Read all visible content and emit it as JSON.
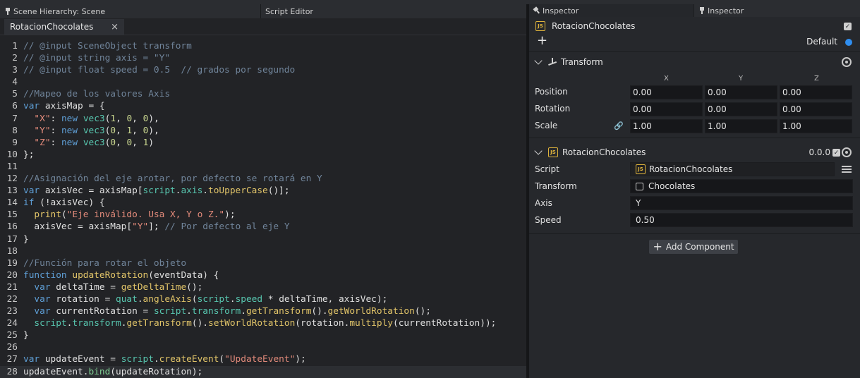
{
  "panel_tabs": {
    "hierarchy": "Scene Hierarchy: Scene",
    "script_editor": "Script Editor"
  },
  "file_tab": {
    "name": "RotacionChocolates",
    "close": "×"
  },
  "code_lines": [
    [
      [
        "c-com",
        "// @input SceneObject transform"
      ]
    ],
    [
      [
        "c-com",
        "// @input string axis = \"Y\""
      ]
    ],
    [
      [
        "c-com",
        "// @input float speed = 0.5  // grados por segundo"
      ]
    ],
    [],
    [
      [
        "c-com",
        "//Mapeo de los valores Axis"
      ]
    ],
    [
      [
        "c-kw",
        "var"
      ],
      [
        "c-plain",
        " axisMap = {"
      ]
    ],
    [
      [
        "c-plain",
        "  "
      ],
      [
        "c-str",
        "\"X\""
      ],
      [
        "c-plain",
        ": "
      ],
      [
        "c-kw",
        "new"
      ],
      [
        "c-plain",
        " "
      ],
      [
        "c-prop",
        "vec3"
      ],
      [
        "c-plain",
        "("
      ],
      [
        "c-num",
        "1"
      ],
      [
        "c-plain",
        ", "
      ],
      [
        "c-num",
        "0"
      ],
      [
        "c-plain",
        ", "
      ],
      [
        "c-num",
        "0"
      ],
      [
        "c-plain",
        "),"
      ]
    ],
    [
      [
        "c-plain",
        "  "
      ],
      [
        "c-str",
        "\"Y\""
      ],
      [
        "c-plain",
        ": "
      ],
      [
        "c-kw",
        "new"
      ],
      [
        "c-plain",
        " "
      ],
      [
        "c-prop",
        "vec3"
      ],
      [
        "c-plain",
        "("
      ],
      [
        "c-num",
        "0"
      ],
      [
        "c-plain",
        ", "
      ],
      [
        "c-num",
        "1"
      ],
      [
        "c-plain",
        ", "
      ],
      [
        "c-num",
        "0"
      ],
      [
        "c-plain",
        "),"
      ]
    ],
    [
      [
        "c-plain",
        "  "
      ],
      [
        "c-str",
        "\"Z\""
      ],
      [
        "c-plain",
        ": "
      ],
      [
        "c-kw",
        "new"
      ],
      [
        "c-plain",
        " "
      ],
      [
        "c-prop",
        "vec3"
      ],
      [
        "c-plain",
        "("
      ],
      [
        "c-num",
        "0"
      ],
      [
        "c-plain",
        ", "
      ],
      [
        "c-num",
        "0"
      ],
      [
        "c-plain",
        ", "
      ],
      [
        "c-num",
        "1"
      ],
      [
        "c-plain",
        ")"
      ]
    ],
    [
      [
        "c-plain",
        "};"
      ]
    ],
    [],
    [
      [
        "c-com",
        "//Asignación del eje arotar, por defecto se rotará en Y"
      ]
    ],
    [
      [
        "c-kw",
        "var"
      ],
      [
        "c-plain",
        " axisVec = axisMap["
      ],
      [
        "c-prop",
        "script"
      ],
      [
        "c-plain",
        "."
      ],
      [
        "c-prop",
        "axis"
      ],
      [
        "c-plain",
        "."
      ],
      [
        "c-fn",
        "toUpperCase"
      ],
      [
        "c-plain",
        "()];"
      ]
    ],
    [
      [
        "c-kw",
        "if"
      ],
      [
        "c-plain",
        " (!axisVec) {"
      ]
    ],
    [
      [
        "c-plain",
        "  "
      ],
      [
        "c-fn",
        "print"
      ],
      [
        "c-plain",
        "("
      ],
      [
        "c-str",
        "\"Eje inválido. Usa X, Y o Z.\""
      ],
      [
        "c-plain",
        ");"
      ]
    ],
    [
      [
        "c-plain",
        "  axisVec = axisMap["
      ],
      [
        "c-str",
        "\"Y\""
      ],
      [
        "c-plain",
        "]; "
      ],
      [
        "c-com",
        "// Por defecto al eje Y"
      ]
    ],
    [
      [
        "c-plain",
        "}"
      ]
    ],
    [],
    [
      [
        "c-com",
        "//Función para rotar el objeto"
      ]
    ],
    [
      [
        "c-kw",
        "function"
      ],
      [
        "c-plain",
        " "
      ],
      [
        "c-fn",
        "updateRotation"
      ],
      [
        "c-plain",
        "(eventData) {"
      ]
    ],
    [
      [
        "c-plain",
        "  "
      ],
      [
        "c-kw",
        "var"
      ],
      [
        "c-plain",
        " deltaTime = "
      ],
      [
        "c-fn",
        "getDeltaTime"
      ],
      [
        "c-plain",
        "();"
      ]
    ],
    [
      [
        "c-plain",
        "  "
      ],
      [
        "c-kw",
        "var"
      ],
      [
        "c-plain",
        " rotation = "
      ],
      [
        "c-prop",
        "quat"
      ],
      [
        "c-plain",
        "."
      ],
      [
        "c-fn",
        "angleAxis"
      ],
      [
        "c-plain",
        "("
      ],
      [
        "c-prop",
        "script"
      ],
      [
        "c-plain",
        "."
      ],
      [
        "c-prop",
        "speed"
      ],
      [
        "c-plain",
        " * deltaTime, axisVec);"
      ]
    ],
    [
      [
        "c-plain",
        "  "
      ],
      [
        "c-kw",
        "var"
      ],
      [
        "c-plain",
        " currentRotation = "
      ],
      [
        "c-prop",
        "script"
      ],
      [
        "c-plain",
        "."
      ],
      [
        "c-prop",
        "transform"
      ],
      [
        "c-plain",
        "."
      ],
      [
        "c-fn",
        "getTransform"
      ],
      [
        "c-plain",
        "()."
      ],
      [
        "c-fn",
        "getWorldRotation"
      ],
      [
        "c-plain",
        "();"
      ]
    ],
    [
      [
        "c-plain",
        "  "
      ],
      [
        "c-prop",
        "script"
      ],
      [
        "c-plain",
        "."
      ],
      [
        "c-prop",
        "transform"
      ],
      [
        "c-plain",
        "."
      ],
      [
        "c-fn",
        "getTransform"
      ],
      [
        "c-plain",
        "()."
      ],
      [
        "c-fn",
        "setWorldRotation"
      ],
      [
        "c-plain",
        "(rotation."
      ],
      [
        "c-fn",
        "multiply"
      ],
      [
        "c-plain",
        "(currentRotation));"
      ]
    ],
    [
      [
        "c-plain",
        "}"
      ]
    ],
    [],
    [
      [
        "c-kw",
        "var"
      ],
      [
        "c-plain",
        " updateEvent = "
      ],
      [
        "c-prop",
        "script"
      ],
      [
        "c-plain",
        "."
      ],
      [
        "c-fn",
        "createEvent"
      ],
      [
        "c-plain",
        "("
      ],
      [
        "c-str",
        "\"UpdateEvent\""
      ],
      [
        "c-plain",
        ");"
      ]
    ],
    [
      [
        "c-plain",
        "updateEvent."
      ],
      [
        "c-green",
        "bind"
      ],
      [
        "c-plain",
        "(updateRotation);"
      ]
    ]
  ],
  "active_line": 28,
  "inspector": {
    "tab1": "Inspector",
    "tab2": "Inspector",
    "object_name": "RotacionChocolates",
    "js_badge": "JS",
    "layer": "Default",
    "transform": {
      "title": "Transform",
      "axis_x": "X",
      "axis_y": "Y",
      "axis_z": "Z",
      "rows": [
        {
          "label": "Position",
          "x": "0.00",
          "y": "0.00",
          "z": "0.00"
        },
        {
          "label": "Rotation",
          "x": "0.00",
          "y": "0.00",
          "z": "0.00"
        },
        {
          "label": "Scale",
          "x": "1.00",
          "y": "1.00",
          "z": "1.00"
        }
      ]
    },
    "script_component": {
      "title": "RotacionChocolates",
      "version": "0.0.0",
      "script_label": "Script",
      "script_value": "RotacionChocolates",
      "transform_label": "Transform",
      "transform_value": "Chocolates",
      "axis_label": "Axis",
      "axis_value": "Y",
      "speed_label": "Speed",
      "speed_value": "0.50"
    },
    "add_component": "Add Component"
  },
  "colors": {
    "accent_blue": "#2f8ef0",
    "js_yellow": "#e0b43c"
  }
}
